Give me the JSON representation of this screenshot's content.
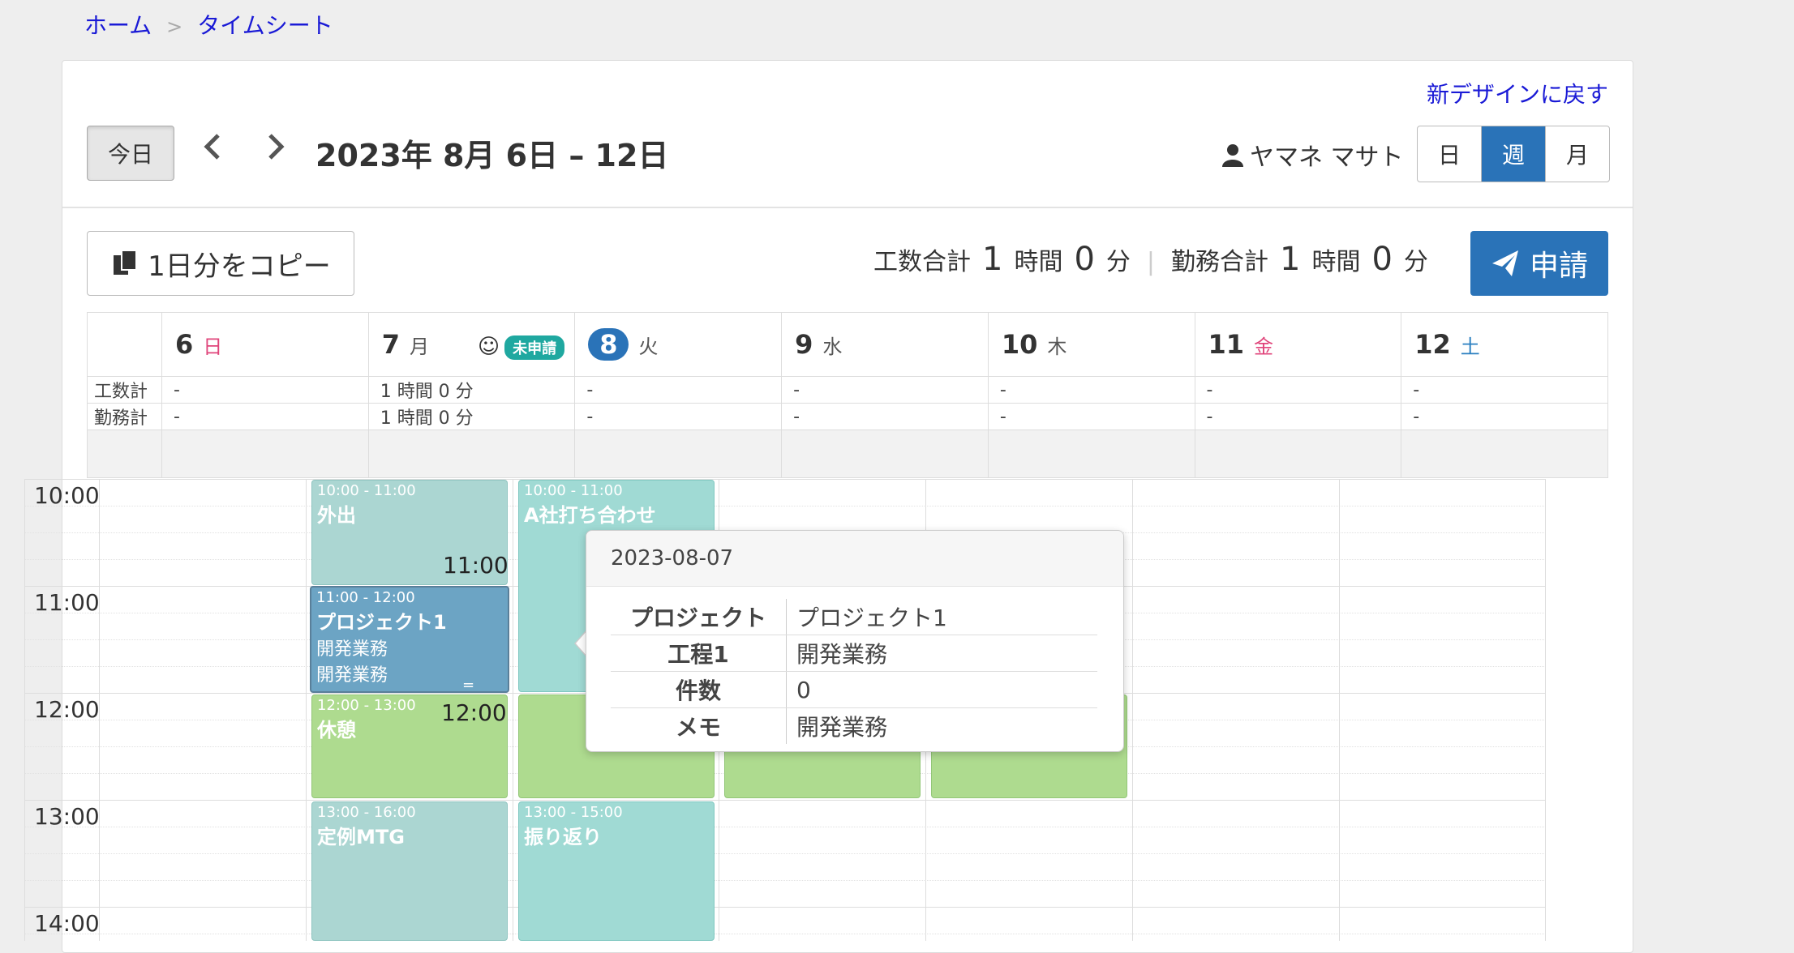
{
  "breadcrumb": {
    "home": "ホーム",
    "sep": ">",
    "current": "タイムシート"
  },
  "header": {
    "new_design_link": "新デザインに戻す",
    "today_button": "今日",
    "prev_icon": "chevron-left-icon",
    "next_icon": "chevron-right-icon",
    "range_title": "2023年 8月 6日 – 12日",
    "user_name": "ヤマネ マサト",
    "views": [
      "日",
      "週",
      "月"
    ],
    "active_view": "週"
  },
  "toolbar": {
    "copy_button": "1日分をコピー",
    "work_total_label": "工数合計",
    "work_total_hours": "1",
    "hours_unit": "時間",
    "work_total_minutes": "0",
    "minutes_unit": "分",
    "attend_total_label": "勤務合計",
    "attend_total_hours": "1",
    "attend_total_minutes": "0",
    "submit_button": "申請"
  },
  "calendar": {
    "row_labels": {
      "work": "工数計",
      "attend": "勤務計"
    },
    "days": [
      {
        "num": "6",
        "weekday": "日",
        "work": "-",
        "attend": "-"
      },
      {
        "num": "7",
        "weekday": "月",
        "work": "1 時間 0 分",
        "attend": "1 時間 0 分",
        "badge": "未申請"
      },
      {
        "num": "8",
        "weekday": "火",
        "work": "-",
        "attend": "-"
      },
      {
        "num": "9",
        "weekday": "水",
        "work": "-",
        "attend": "-"
      },
      {
        "num": "10",
        "weekday": "木",
        "work": "-",
        "attend": "-"
      },
      {
        "num": "11",
        "weekday": "金",
        "work": "-",
        "attend": "-"
      },
      {
        "num": "12",
        "weekday": "土",
        "work": "-",
        "attend": "-"
      }
    ],
    "times": [
      "10:00",
      "11:00",
      "12:00",
      "13:00",
      "14:00"
    ],
    "events": {
      "out": {
        "time": "10:00 - 11:00",
        "name": "外出"
      },
      "meet": {
        "time": "10:00 - 11:00",
        "name": "A社打ち合わせ"
      },
      "proj": {
        "time": "11:00 - 12:00",
        "name": "プロジェクト1",
        "sub1": "開発業務",
        "sub2": "開発業務"
      },
      "rest": {
        "time": "12:00 - 13:00",
        "name": "休憩"
      },
      "mtg": {
        "time": "13:00 - 16:00",
        "name": "定例MTG"
      },
      "rev": {
        "time": "13:00 - 15:00",
        "name": "振り返り"
      }
    },
    "drag_labels": {
      "top": "11:00",
      "bottom": "12:00",
      "handle": "="
    }
  },
  "popover": {
    "title": "2023-08-07",
    "rows": [
      {
        "k": "プロジェクト",
        "v": "プロジェクト1"
      },
      {
        "k": "工程1",
        "v": "開発業務"
      },
      {
        "k": "件数",
        "v": "0"
      },
      {
        "k": "メモ",
        "v": "開発業務"
      }
    ]
  }
}
